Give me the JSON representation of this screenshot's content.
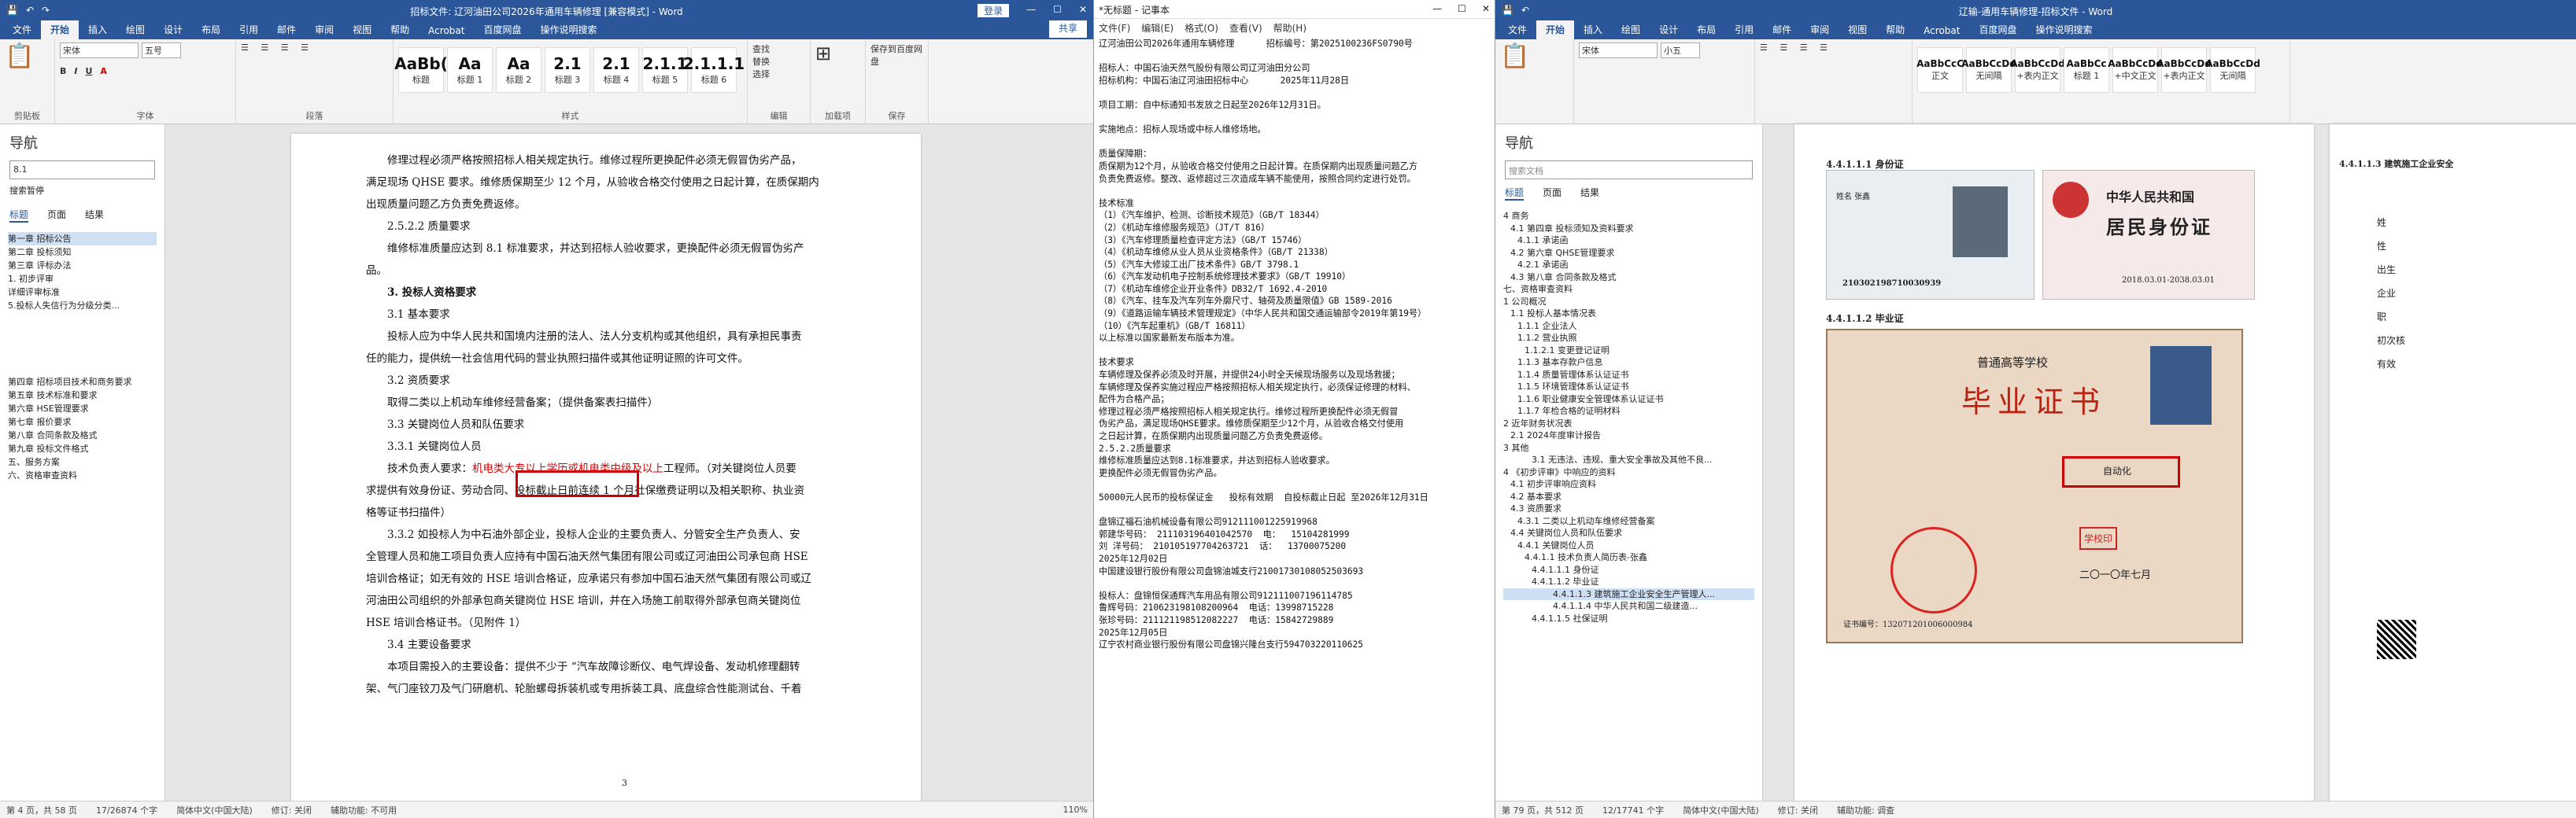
{
  "left_word": {
    "title": "招标文件: 辽河油田公司2026年通用车辆修理 [兼容模式] - Word",
    "login": "登录",
    "share": "共享",
    "tabs": [
      "文件",
      "开始",
      "插入",
      "绘图",
      "设计",
      "布局",
      "引用",
      "邮件",
      "审阅",
      "视图",
      "帮助",
      "Acrobat",
      "百度网盘",
      "操作说明搜索"
    ],
    "font": "宋体",
    "size": "五号",
    "styles": [
      {
        "sample": "AaBb(",
        "name": "标题"
      },
      {
        "sample": "Aa",
        "name": "标题 1"
      },
      {
        "sample": "Aa",
        "name": "标题 2"
      },
      {
        "sample": "2.1",
        "name": "标题 3"
      },
      {
        "sample": "2.1",
        "name": "标题 4"
      },
      {
        "sample": "2.1.1",
        "name": "标题 5"
      },
      {
        "sample": "2.1.1.1",
        "name": "标题 6"
      }
    ],
    "groups": [
      "剪贴板",
      "字体",
      "段落",
      "样式",
      "编辑",
      "加载项",
      "保存"
    ],
    "edit_items": [
      "查找",
      "替换",
      "选择"
    ],
    "save_label": "保存到百度网盘",
    "nav": {
      "title": "导航",
      "search": "8.1",
      "result": "搜索暂停",
      "tabs": [
        "标题",
        "页面",
        "结果"
      ],
      "items": [
        "第一章 招标公告",
        "第二章 投标须知",
        "第三章 评标办法",
        "1. 初步评审",
        "详细评审标准",
        "5.投标人失信行为分级分类...",
        "第四章 招标项目技术和商务要求",
        "第五章 技术标准和要求",
        "第六章 HSE管理要求",
        "第七章 报价要求",
        "第八章 合同条款及格式",
        "第九章 投标文件格式",
        "五、服务方案",
        "六、资格审查资料"
      ]
    },
    "body": [
      {
        "t": "修理过程必须严格按照招标人相关规定执行。维修过程所更换配件必须无假冒伪劣产品，",
        "c": ""
      },
      {
        "t": "满足现场 QHSE 要求。维修质保期至少 12 个月，从验收合格交付使用之日起计算，在质保期内",
        "c": ""
      },
      {
        "t": "出现质量问题乙方负责免费返修。",
        "c": ""
      },
      {
        "t": "2.5.2.2 质量要求",
        "c": ""
      },
      {
        "t": "维修标准质量应达到 8.1 标准要求，并达到招标人验收要求，更换配件必须无假冒伪劣产",
        "c": ""
      },
      {
        "t": "品。",
        "c": ""
      },
      {
        "t": "3. 投标人资格要求",
        "c": "b"
      },
      {
        "t": "3.1 基本要求",
        "c": ""
      },
      {
        "t": "投标人应为中华人民共和国境内注册的法人、法人分支机构或其他组织，具有承担民事责",
        "c": "red"
      },
      {
        "t": "任的能力，提供统一社会信用代码的营业执照扫描件或其他证明证照的许可文件。",
        "c": "red"
      },
      {
        "t": "3.2 资质要求",
        "c": "red"
      },
      {
        "t": "取得二类以上机动车维修经营备案；（提供备案表扫描件）",
        "c": "red"
      },
      {
        "t": "3.3 关键岗位人员和队伍要求",
        "c": ""
      },
      {
        "t": "3.3.1 关键岗位人员",
        "c": ""
      },
      {
        "t": "技术负责人要求：机电类大专以上学历或机电类中级及以上工程师。（对关键岗位人员要",
        "c": "mix"
      },
      {
        "t": "求提供有效身份证、劳动合同、投标截止日前连续 1 个月社保缴费证明以及相关职称、执业资",
        "c": "red"
      },
      {
        "t": "格等证书扫描件）",
        "c": ""
      },
      {
        "t": "3.3.2 如投标人为中石油外部企业，投标人企业的主要负责人、分管安全生产负责人、安",
        "c": ""
      },
      {
        "t": "全管理人员和施工项目负责人应持有中国石油天然气集团有限公司或辽河油田公司承包商 HSE",
        "c": ""
      },
      {
        "t": "培训合格证；如无有效的 HSE 培训合格证，应承诺只有参加中国石油天然气集团有限公司或辽",
        "c": ""
      },
      {
        "t": "河油田公司组织的外部承包商关键岗位 HSE 培训，并在入场施工前取得外部承包商关键岗位",
        "c": ""
      },
      {
        "t": "HSE 培训合格证书。（见附件 1）",
        "c": ""
      },
      {
        "t": "3.4 主要设备要求",
        "c": ""
      },
      {
        "t": "本项目需投入的主要设备：提供不少于 “汽车故障诊断仪、电气焊设备、发动机修理翻转",
        "c": ""
      },
      {
        "t": "架、气门座铰刀及气门研磨机、轮胎螺母拆装机或专用拆装工具、底盘综合性能测试台、千着",
        "c": ""
      }
    ],
    "page_num": "3",
    "status": [
      "第 4 页，共 58 页",
      "17/26874 个字",
      "简体中文(中国大陆)",
      "修订: 关闭",
      "辅助功能: 不可用"
    ],
    "zoom": "110%"
  },
  "notepad": {
    "title": "*无标题 - 记事本",
    "menu": [
      "文件(F)",
      "编辑(E)",
      "格式(O)",
      "查看(V)",
      "帮助(H)"
    ],
    "lines": [
      "辽河油田公司2026年通用车辆修理      招标编号：第2025100236FS0790号",
      "",
      "招标人：中国石油天然气股份有限公司辽河油田分公司",
      "招标机构：中国石油辽河油田招标中心      2025年11月28日",
      "",
      "项目工期：自中标通知书发放之日起至2026年12月31日。",
      "",
      "实施地点：招标人现场或中标人维修场地。",
      "",
      "质量保障期：",
      "质保期为12个月，从验收合格交付使用之日起计算。在质保期内出现质量问题乙方",
      "负责免费返修。整改、返修超过三次造成车辆不能使用，按照合同约定进行处罚。",
      "",
      "技术标准",
      "（1）《汽车维护、检测、诊断技术规范》（GB/T 18344）",
      "（2）《机动车维修服务规范》（JT/T 816）",
      "（3）《汽车修理质量检查评定方法》（GB/T 15746）",
      "（4）《机动车维修从业人员从业资格条件》（GB/T 21338）",
      "（5）《汽车大修竣工出厂技术条件》GB/T 3798.1",
      "（6）《汽车发动机电子控制系统修理技术要求》（GB/T 19910）",
      "（7）《机动车维修企业开业条件》DB32/T 1692.4-2010",
      "（8）《汽车、挂车及汽车列车外廓尺寸、轴荷及质量限值》GB 1589-2016",
      "（9）《道路运输车辆技术管理规定》（中华人民共和国交通运输部令2019年第19号）",
      "（10）《汽车起重机》（GB/T 16811）",
      "以上标准以国家最新发布版本为准。",
      "",
      "技术要求",
      "车辆修理及保养必须及时开展，并提供24小时全天候现场服务以及现场救援；",
      "车辆修理及保养实施过程应严格按照招标人相关规定执行，必须保证修理的材料、",
      "配件为合格产品；",
      "修理过程必须严格按照招标人相关规定执行。维修过程所更换配件必须无假冒",
      "伪劣产品，满足现场QHSE要求。维修质保期至少12个月，从验收合格交付使用",
      "之日起计算，在质保期内出现质量问题乙方负责免费返修。",
      "2.5.2.2质量要求",
      "维修标准质量应达到8.1标准要求，并达到招标人验收要求。",
      "更换配件必须无假冒伪劣产品。",
      "",
      "50000元人民币的投标保证金   投标有效期  自投标截止日起 至2026年12月31日",
      "",
      "盘锦辽福石油机械设备有限公司9121110012259199​68",
      "郭建华号码： 211103196401042570  电：  15104281999",
      "刘 洋号码： 210105197704263721  话：  13700075200",
      "2025年12月02日",
      "中国建设银行股份有限公司盘锦油城支行210017301080525​03693",
      "",
      "投标人：盘锦恒保通辉汽车用品有限公司912111007196114785",
      "鲁辉号码：210623198108200964  电话：13998715228",
      "张珍号码：211121198512082227  电话：15842729889",
      "2025年12月05日",
      "辽宁农村商业银行股份有限公司盘锦兴隆台支行594703220110625"
    ]
  },
  "right_word": {
    "title": "辽输-通用车辆修理-招标文件 - Word",
    "tabs": [
      "文件",
      "开始",
      "插入",
      "绘图",
      "设计",
      "布局",
      "引用",
      "邮件",
      "审阅",
      "视图",
      "帮助",
      "Acrobat",
      "百度网盘",
      "操作说明搜索"
    ],
    "font": "宋体",
    "size": "小五",
    "styles": [
      {
        "sample": "AaBbCcC",
        "name": "正文"
      },
      {
        "sample": "AaBbCcDd",
        "name": "无间隔"
      },
      {
        "sample": "AaBbCcDd",
        "name": "+表内正文"
      },
      {
        "sample": "AaBbCc",
        "name": "标题 1"
      },
      {
        "sample": "AaBbCcDd",
        "name": "+中文正文"
      },
      {
        "sample": "AaBbCcDd",
        "name": "+表内正文"
      },
      {
        "sample": "AaBbCcDd",
        "name": "无间隔"
      }
    ],
    "nav": {
      "title": "导航",
      "search": "搜索文档",
      "tabs": [
        "标题",
        "页面",
        "结果"
      ],
      "items": [
        "4 商务",
        "4.1 第四章 投标须知及资料要求",
        "4.1.1 承诺函",
        "4.2 第六章 QHSE管理要求",
        "4.2.1 承诺函",
        "4.3 第八章 合同条款及格式",
        "七、资格审查资料",
        "1 公司概况",
        "1.1 投标人基本情况表",
        "1.1.1 企业法人",
        "1.1.2 营业执照",
        "1.1.2.1 变更登记证明",
        "1.1.3 基本存款户信息",
        "1.1.4 质量管理体系认证证书",
        "1.1.5 环境管理体系认证证书",
        "1.1.6 职业健康安全管理体系认证证书",
        "1.1.7 年检合格的证明材料",
        "2 近年财务状况表",
        "2.1 2024年度审计报告",
        "3 其他",
        "3.1 无违法、违规、重大安全事故及其他不良...",
        "4 《初步评审》中响应的资料",
        "4.1 初步评审响应资料",
        "4.2 基本要求",
        "4.3 资质要求",
        "4.3.1 二类以上机动车维修经营备案",
        "4.4 关键岗位人员和队伍要求",
        "4.4.1 关键岗位人员",
        "4.4.1.1 技术负责人简历表-张鑫",
        "4.4.1.1.1 身份证",
        "4.4.1.1.2 毕业证",
        "4.4.1.1.3 建筑施工企业安全生产管理人...",
        "4.4.1.1.4 中华人民共和国二级建造...",
        "4.4.1.1.5 社保证明"
      ],
      "selected_index": 31
    },
    "doc": {
      "h1": "4.4.1.1.1 身份证",
      "h2": "4.4.1.1.2 毕业证",
      "h3": "4.4.1.1.3 建筑施工企业安全",
      "id_front": {
        "name_label": "姓名",
        "name": "张鑫",
        "id": "210302198710030939"
      },
      "id_back": {
        "country": "中华人民共和国",
        "title": "居民身份证",
        "dates": "2018.03.01-2038.03.01"
      },
      "diploma": {
        "top": "普通高等学校",
        "title": "毕业证书",
        "school_seal": "学校印",
        "major": "自动化",
        "cert_no": "证书编号：132071201006000984",
        "date": "二〇一〇年七月"
      },
      "side": [
        "姓",
        "性",
        "出生",
        "企业",
        "职",
        "初次核",
        "有效"
      ]
    },
    "status": [
      "第 79 页，共 512 页",
      "12/17741 个字",
      "简体中文(中国大陆)",
      "修订: 关闭",
      "辅助功能: 调查"
    ]
  }
}
